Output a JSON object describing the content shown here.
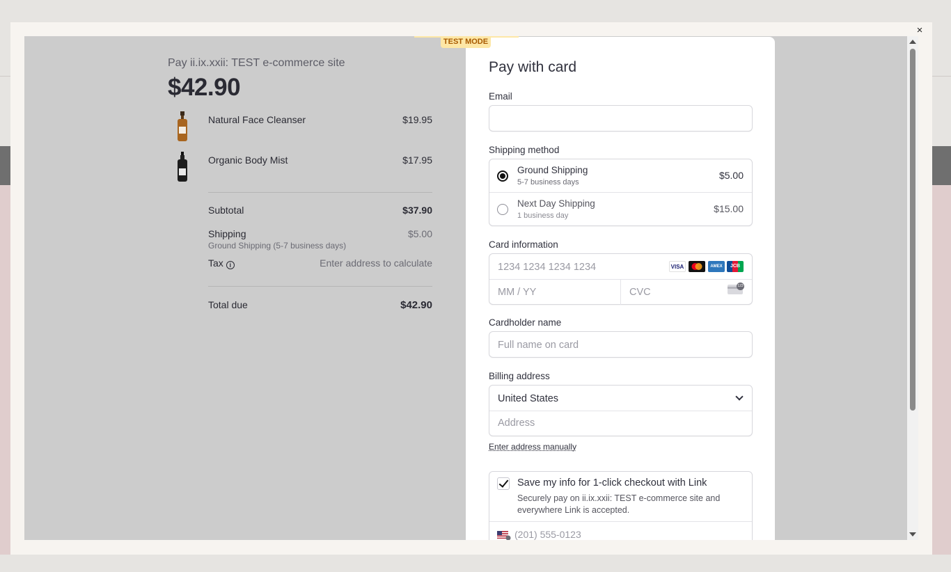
{
  "modal": {
    "close_label": "×"
  },
  "banner": {
    "test_mode": "TEST MODE"
  },
  "summary": {
    "merchant": "Pay ii.ix.xxii: TEST e-commerce site",
    "amount": "$42.90",
    "items": [
      {
        "name": "Natural Face Cleanser",
        "price": "$19.95"
      },
      {
        "name": "Organic Body Mist",
        "price": "$17.95"
      }
    ],
    "subtotal_label": "Subtotal",
    "subtotal_value": "$37.90",
    "shipping_label": "Shipping",
    "shipping_value": "$5.00",
    "shipping_sub": "Ground Shipping (5-7 business days)",
    "tax_label": "Tax",
    "tax_info_icon": "i",
    "tax_value": "Enter address to calculate",
    "total_label": "Total due",
    "total_value": "$42.90"
  },
  "pay": {
    "title": "Pay with card",
    "email_label": "Email",
    "email_value": "",
    "shipping_method_label": "Shipping method",
    "shipping_options": [
      {
        "name": "Ground Shipping",
        "sub": "5-7 business days",
        "price": "$5.00",
        "selected": true
      },
      {
        "name": "Next Day Shipping",
        "sub": "1 business day",
        "price": "$15.00",
        "selected": false
      }
    ],
    "card_info_label": "Card information",
    "card_number_placeholder": "1234 1234 1234 1234",
    "card_brands": [
      "VISA",
      "MC",
      "AMEX",
      "JCB"
    ],
    "expiry_placeholder": "MM / YY",
    "cvc_placeholder": "CVC",
    "cvc_badge": "123",
    "cardholder_label": "Cardholder name",
    "cardholder_placeholder": "Full name on card",
    "billing_label": "Billing address",
    "country_value": "United States",
    "address_placeholder": "Address",
    "enter_manually": "Enter address manually",
    "save_info_title": "Save my info for 1-click checkout with Link",
    "save_info_desc_1": "Securely pay on ii.ix.xxii: TEST e-commerce site and",
    "save_info_desc_2": "everywhere Link is accepted.",
    "phone_placeholder": "(201) 555-0123"
  },
  "colors": {
    "overlay": "#cccccc",
    "panel": "#ffffff",
    "test_mode_bg": "#fde7a6",
    "test_mode_text": "#a85a00",
    "visa": "#1a1f71",
    "mastercard_red": "#eb001b",
    "mastercard_yellow": "#f79e1b",
    "amex": "#2e77bc"
  }
}
